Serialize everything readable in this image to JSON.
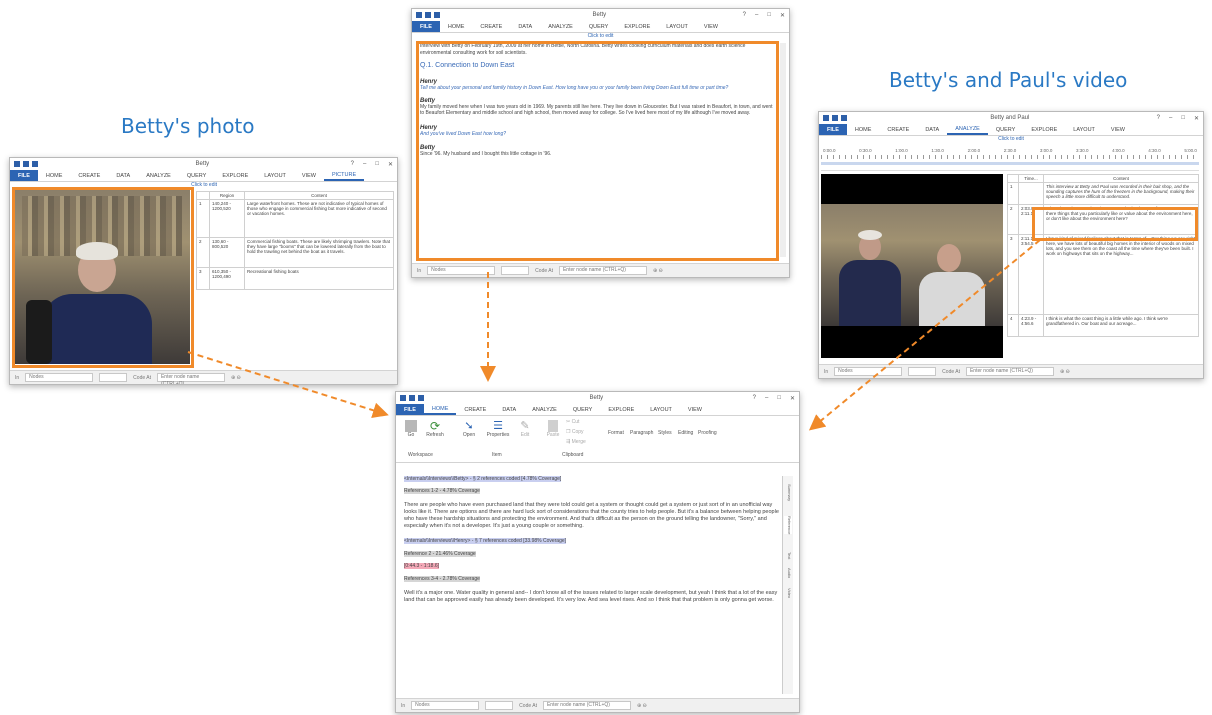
{
  "captions": {
    "betty_photo": "Betty's photo",
    "betty_paul_video": "Betty's and Paul's video"
  },
  "common": {
    "click_to_edit": "Click to edit",
    "nodes": "Nodes",
    "code_at": "Code At",
    "enter_node": "Enter node name (CTRL+Q)"
  },
  "photo_window": {
    "title": "Betty",
    "tabs": [
      "FILE",
      "HOME",
      "CREATE",
      "DATA",
      "ANALYZE",
      "QUERY",
      "EXPLORE",
      "LAYOUT",
      "VIEW",
      "PICTURE"
    ],
    "columns": [
      "Region",
      "Content"
    ],
    "rows": [
      {
        "num": "1",
        "region": "140,240 - 1200,520",
        "content": "Large waterfront homes. These are not indicative of typical homes of those who engage in commercial fishing but more indicative of second or vacation homes."
      },
      {
        "num": "2",
        "region": "130,60 - 800,520",
        "content": "Commercial fishing boats. These are likely shrimping trawlers. Note that they have large \"booms\" that can be lowered laterally from the boat to hold the trawling net behind the boat as it travels."
      },
      {
        "num": "3",
        "region": "610,350 - 1200,490",
        "content": "Recreational fishing boats"
      }
    ]
  },
  "transcript_window": {
    "title": "Betty",
    "tabs": [
      "FILE",
      "HOME",
      "CREATE",
      "DATA",
      "ANALYZE",
      "QUERY",
      "EXPLORE",
      "LAYOUT",
      "VIEW"
    ],
    "intro": "Interview with Betty on February 19th, 2009 at her home in Bettie, North Carolina. Betty writes cooking curriculum materials and does earth science environmental consulting work for soil scientists.",
    "heading": "Q.1. Connection to Down East",
    "speaker1": "Henry",
    "q1": "Tell me about your personal and family history in Down East. How long have you or your family been living Down East full time or part time?",
    "speaker2": "Betty",
    "a1": "My family moved here when I was two years old in 1969. My parents still live here. They live down in Gloucester. But I was raised in Beaufort, in town, and went to Beaufort Elementary and middle school and high school, then moved away for college. So I've lived here most of my life although I've moved away.",
    "speaker3": "Henry",
    "q2": "And you've lived Down East how long?",
    "speaker4": "Betty",
    "a2": "Since '96. My husband and I bought this little cottage in '96."
  },
  "video_window": {
    "title": "Betty and Paul",
    "tabs": [
      "FILE",
      "HOME",
      "CREATE",
      "DATA",
      "ANALYZE",
      "QUERY",
      "EXPLORE",
      "LAYOUT",
      "VIEW"
    ],
    "timeline": [
      "0:00.0",
      "0:30.0",
      "1:00.0",
      "1:30.0",
      "2:00.0",
      "2:30.0",
      "3:00.0",
      "3:30.0",
      "4:00.0",
      "4:30.0",
      "5:00.0"
    ],
    "columns": [
      "Time...",
      "Content"
    ],
    "rows": [
      {
        "num": "1",
        "time": "",
        "content": "This interview at Betty and Paul was recorded in their bait shop, and the sounding captures the hum of the freezers in the background, making their speech a little more difficult to understand."
      },
      {
        "num": "2",
        "time": "2:03.0 - 2:11.1",
        "content": "What about the natural environment or the landscape of Down East? Are there things that you particularly like or value about the environment here, or don't like about the environment here?"
      },
      {
        "num": "3",
        "time": "2:11.1 - 3:54.5",
        "content": "I have kind of mixed feelings about that in terms of... Our thing we say right here, we have lots of beautiful big homes in the interior of woods on mixed lots, and you see them on the coast all the time where they've been built. I work on highways that sits on the highway..."
      },
      {
        "num": "4",
        "time": "4:23.9 - 4:56.6",
        "content": "I think is what the coast thing is a little while ago. I think we're grandfathered in. Our boat and our acreage..."
      }
    ]
  },
  "query_window": {
    "title": "Betty",
    "tabs": [
      "FILE",
      "HOME",
      "CREATE",
      "DATA",
      "ANALYZE",
      "QUERY",
      "EXPLORE",
      "LAYOUT",
      "VIEW"
    ],
    "groups": {
      "workspace": "Workspace",
      "item": "Item",
      "clipboard": "Clipboard"
    },
    "buttons": {
      "go": "Go",
      "refresh": "Refresh",
      "open": "Open",
      "properties": "Properties",
      "edit": "Edit",
      "paste": "Paste",
      "cut": "Cut",
      "copy": "Copy",
      "merge": "Merge",
      "format": "Format",
      "paragraph": "Paragraph",
      "styles": "Styles",
      "editing": "Editing",
      "proofing": "Proofing"
    },
    "source1": "<Internals\\\\Interviews\\\\Betty> - § 2 references coded [4.78% Coverage]",
    "ref1": "References 1-2 - 4.78% Coverage",
    "para1": "There are people who have even purchased land that they were told could get a system or thought could get a system or just sort of in an unofficial way looks like it. There are options and there are hard luck sort of considerations that the county tries to help people. But it's a balance between helping people who have these hardship situations and protecting the environment. And that's difficult as the person on the ground telling the landowner, \"Sorry,\" and especially when it's not a developer. It's just a young couple or something.",
    "source2": "<Internals\\\\Interviews\\\\Henry> - § 7 references coded [33.98% Coverage]",
    "ref2": "Reference 2 - 21.46% Coverage",
    "timecode": "[0:44.3 - 1:18.6]",
    "ref3": "References 3-4 - 2.78% Coverage",
    "para2": "Well it's a major one. Water quality in general and-- I don't know all of the issues related to larger scale development, but yeah I think that a lot of the easy land that can be approved easily has already been developed. It's very low. And sea level rises. And so I think that that problem is only gonna get worse.",
    "side_tabs": [
      "Summary",
      "Reference",
      "Text",
      "Audio",
      "Video"
    ]
  }
}
